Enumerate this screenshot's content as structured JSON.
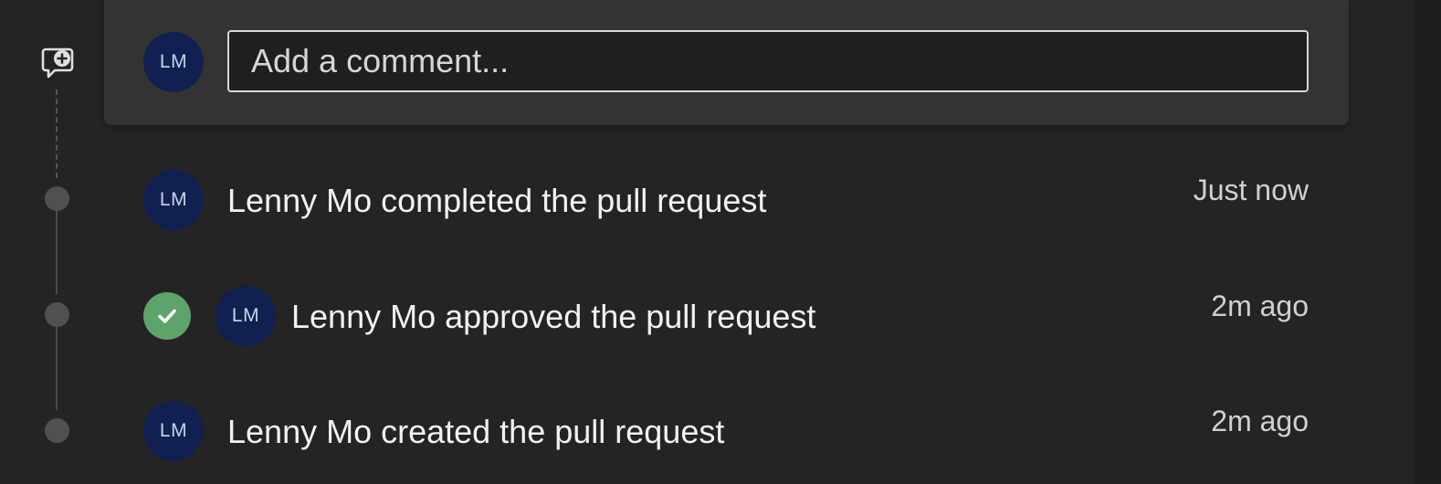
{
  "composer": {
    "avatar_initials": "LM",
    "placeholder": "Add a comment..."
  },
  "timeline": [
    {
      "avatar_initials": "LM",
      "text": "Lenny Mo completed the pull request",
      "time": "Just now"
    },
    {
      "avatar_initials": "LM",
      "text": "Lenny Mo approved the pull request",
      "time": "2m ago",
      "badge": "approved-check-icon"
    },
    {
      "avatar_initials": "LM",
      "text": "Lenny Mo created the pull request",
      "time": "2m ago"
    }
  ],
  "colors": {
    "background": "#242424",
    "card": "#333333",
    "avatar": "#102050",
    "approved": "#5ea36a"
  }
}
